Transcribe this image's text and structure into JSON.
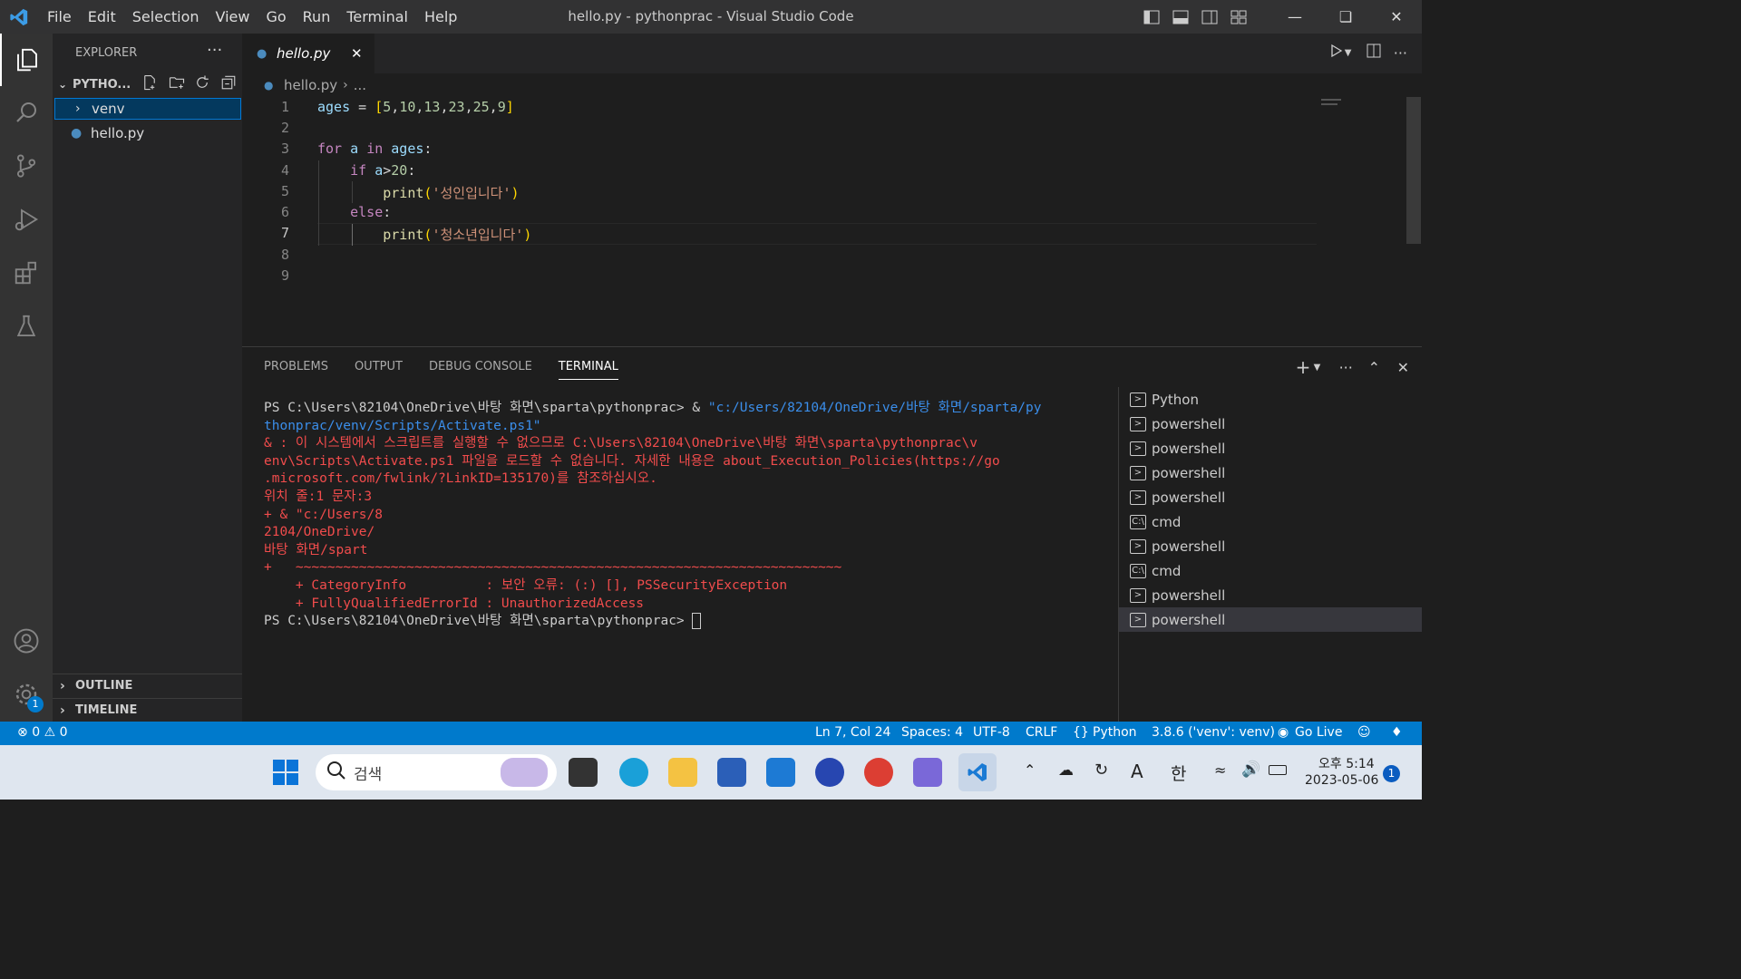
{
  "window": {
    "title": "hello.py - pythonprac - Visual Studio Code"
  },
  "menu": [
    "File",
    "Edit",
    "Selection",
    "View",
    "Go",
    "Run",
    "Terminal",
    "Help"
  ],
  "explorer": {
    "title": "EXPLORER",
    "folder": "PYTHO...",
    "items": [
      {
        "label": "venv",
        "type": "folder"
      },
      {
        "label": "hello.py",
        "type": "file"
      }
    ],
    "outline": "OUTLINE",
    "timeline": "TIMELINE"
  },
  "tab": {
    "label": "hello.py"
  },
  "breadcrumb": {
    "file": "hello.py",
    "rest": "..."
  },
  "editor": {
    "line_numbers": [
      "1",
      "2",
      "3",
      "4",
      "5",
      "6",
      "7",
      "8",
      "9"
    ]
  },
  "panel": {
    "tabs": [
      "PROBLEMS",
      "OUTPUT",
      "DEBUG CONSOLE",
      "TERMINAL"
    ],
    "active_tab": "TERMINAL"
  },
  "terminal": {
    "lines": [
      {
        "c": "t-w",
        "t": "PS C:\\Users\\82104\\OneDrive\\바탕 화면\\sparta\\pythonprac> & ",
        "b": "\"c:/Users/82104/OneDrive/바탕 화면/sparta/py"
      },
      {
        "c": "t-b",
        "t": "thonprac/venv/Scripts/Activate.ps1\""
      },
      {
        "c": "t-r",
        "t": "& : 이 시스템에서 스크립트를 실행할 수 없으므로 C:\\Users\\82104\\OneDrive\\바탕 화면\\sparta\\pythonprac\\v"
      },
      {
        "c": "t-r",
        "t": "env\\Scripts\\Activate.ps1 파일을 로드할 수 없습니다. 자세한 내용은 about_Execution_Policies(https://go"
      },
      {
        "c": "t-r",
        "t": ".microsoft.com/fwlink/?LinkID=135170)를 참조하십시오."
      },
      {
        "c": "t-r",
        "t": "위치 줄:1 문자:3"
      },
      {
        "c": "t-r",
        "t": "+ & \"c:/Users/8"
      },
      {
        "c": "t-r",
        "t": "2104/OneDrive/"
      },
      {
        "c": "t-r",
        "t": "바탕 화면/spart"
      },
      {
        "c": "t-r",
        "t": "+   ~~~~~~~~~~~~~~~~~~~~~~~~~~~~~~~~~~~~~~~~~~~~~~~~~~~~~~~~~~~~~~~~~~~~~"
      },
      {
        "c": "t-r",
        "t": "    + CategoryInfo          : 보안 오류: (:) [], PSSecurityException"
      },
      {
        "c": "t-r",
        "t": "    + FullyQualifiedErrorId : UnauthorizedAccess"
      },
      {
        "c": "t-w",
        "t": "PS C:\\Users\\82104\\OneDrive\\바탕 화면\\sparta\\pythonprac> "
      }
    ],
    "sessions": [
      {
        "label": "Python",
        "icon": "ps"
      },
      {
        "label": "powershell",
        "icon": "ps"
      },
      {
        "label": "powershell",
        "icon": "ps"
      },
      {
        "label": "powershell",
        "icon": "ps"
      },
      {
        "label": "powershell",
        "icon": "ps"
      },
      {
        "label": "cmd",
        "icon": "cmd"
      },
      {
        "label": "powershell",
        "icon": "ps"
      },
      {
        "label": "cmd",
        "icon": "cmd"
      },
      {
        "label": "powershell",
        "icon": "ps"
      },
      {
        "label": "powershell",
        "icon": "ps"
      }
    ]
  },
  "status": {
    "errors": "0",
    "warnings": "0",
    "position": "Ln 7, Col 24",
    "spaces": "Spaces: 4",
    "encoding": "UTF-8",
    "eol": "CRLF",
    "language": "Python",
    "interpreter": "3.8.6 ('venv': venv)",
    "golive": "Go Live",
    "settings_badge": "1"
  },
  "taskbar": {
    "search_placeholder": "검색",
    "ime": "한",
    "ime_a": "A",
    "time": "오후 5:14",
    "date": "2023-05-06",
    "notif": "1"
  },
  "colors": {
    "accent": "#007acc",
    "titlebar": "#323233"
  }
}
